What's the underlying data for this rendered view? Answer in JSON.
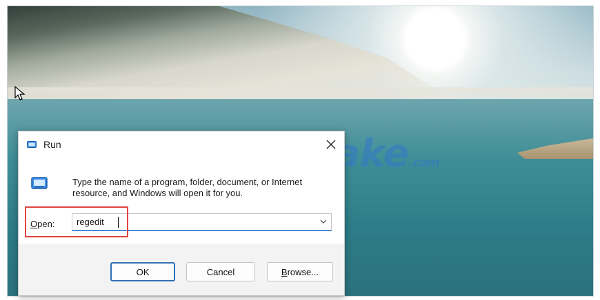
{
  "wallpaper": {
    "watermark": "TipsMake",
    "watermark_suffix": ".com"
  },
  "dialog": {
    "title": "Run",
    "description": "Type the name of a program, folder, document, or Internet resource, and Windows will open it for you.",
    "open_label_accel": "O",
    "open_label_rest": "pen:",
    "open_value": "regedit",
    "buttons": {
      "ok": "OK",
      "cancel": "Cancel",
      "browse_accel": "B",
      "browse_rest": "rowse..."
    }
  },
  "colors": {
    "highlight": "#e0443f",
    "accent": "#2f6fb7"
  }
}
